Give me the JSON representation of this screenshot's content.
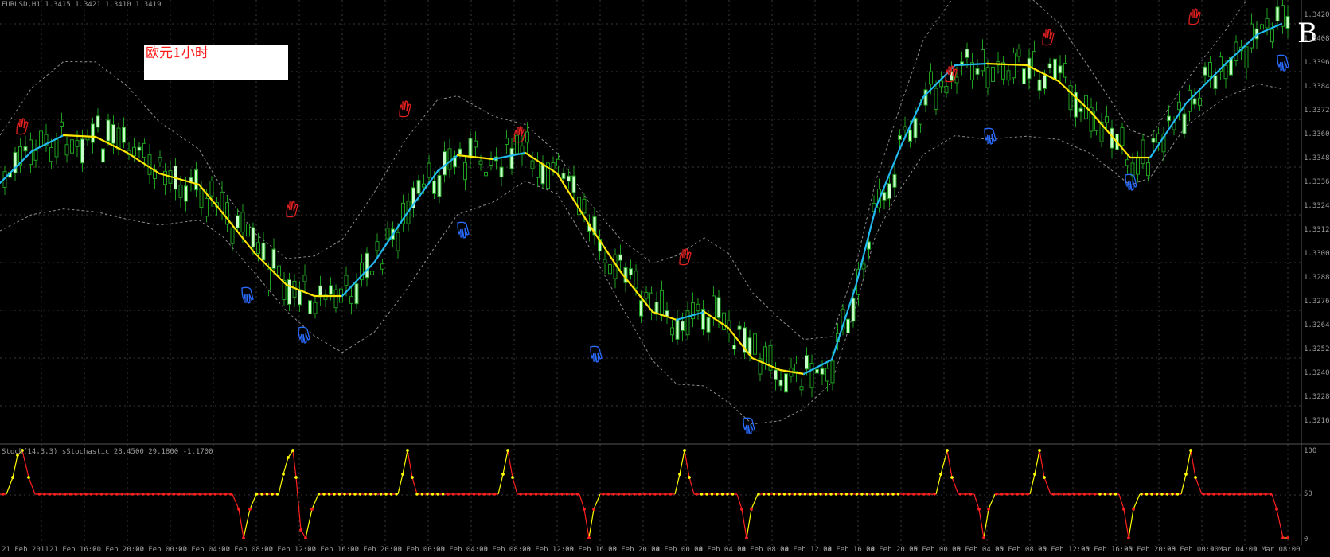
{
  "window": {
    "title": "EURUSD,H1 1.3415 1.3421 1.3410 1.3419",
    "indicator_title": "Stoch(14,3,3) sStochastic 28.4500 29.1800 -1.1700"
  },
  "annotations": {
    "label_box_text": "欧元1小时",
    "corner_letter": "B"
  },
  "price_axis": {
    "labels": [
      "1.3420",
      "1.3408",
      "1.3396",
      "1.3384",
      "1.3372",
      "1.3360",
      "1.3348",
      "1.3336",
      "1.3324",
      "1.3312",
      "1.3300",
      "1.3288",
      "1.3276",
      "1.3264",
      "1.3252",
      "1.3240",
      "1.3228",
      "1.3216"
    ]
  },
  "indicator_axis": {
    "labels": [
      "100",
      "50",
      "0"
    ]
  },
  "time_axis": {
    "labels": [
      "21 Feb 2011",
      "21 Feb 16:00",
      "21 Feb 20:00",
      "22 Feb 00:00",
      "22 Feb 04:00",
      "22 Feb 08:00",
      "22 Feb 12:00",
      "22 Feb 16:00",
      "22 Feb 20:00",
      "23 Feb 00:00",
      "23 Feb 04:00",
      "23 Feb 08:00",
      "23 Feb 12:00",
      "23 Feb 16:00",
      "23 Feb 20:00",
      "24 Feb 00:00",
      "24 Feb 04:00",
      "24 Feb 08:00",
      "24 Feb 12:00",
      "24 Feb 16:00",
      "24 Feb 20:00",
      "25 Feb 00:00",
      "25 Feb 04:00",
      "25 Feb 08:00",
      "25 Feb 12:00",
      "25 Feb 16:00",
      "25 Feb 20:00",
      "28 Feb 00:00",
      "1 Mar 04:00",
      "1 Mar 08:00"
    ]
  },
  "colors": {
    "background": "#000000",
    "grid": "#3a3a3a",
    "bull_candle": "#c8ffc8",
    "bear_candle": "#1e9e1e",
    "ma_up": "#22b8f0",
    "ma_down": "#ffe600",
    "bollinger": "#8c8c8c",
    "sell_marker": "#e02020",
    "buy_marker": "#2a6cff",
    "stoch_high": "#ffff00",
    "stoch_low": "#ff2020"
  },
  "markers": {
    "sell_icon": "red-hand-icon",
    "buy_icon": "blue-hand-icon"
  }
}
